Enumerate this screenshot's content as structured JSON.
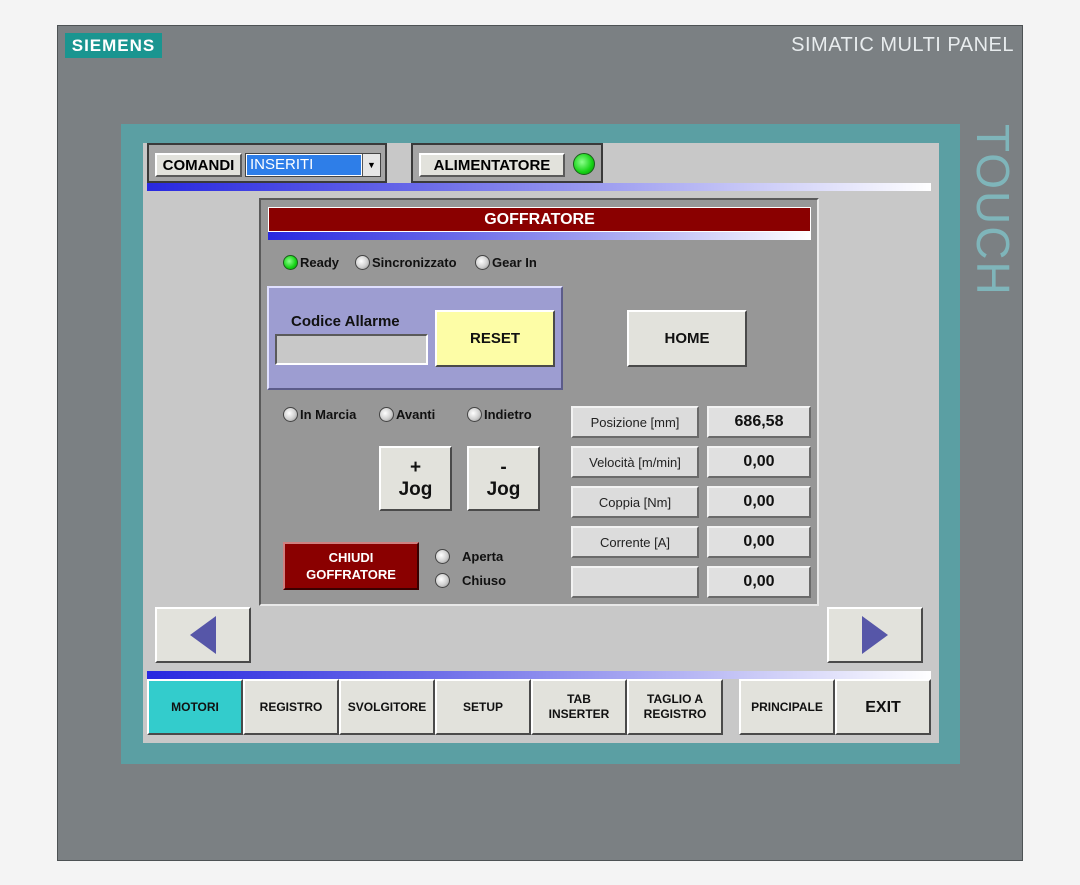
{
  "device": {
    "logo": "SIEMENS",
    "brand": "SIMATIC MULTI PANEL",
    "side_label": "TOUCH"
  },
  "topbar": {
    "comandi_label": "COMANDI",
    "comandi_value": "INSERITI",
    "alimentatore_label": "ALIMENTATORE",
    "alimentatore_state": "on"
  },
  "panel": {
    "title": "GOFFRATORE",
    "status": [
      {
        "label": "Ready",
        "state": "on"
      },
      {
        "label": "Sincronizzato",
        "state": "off"
      },
      {
        "label": "Gear In",
        "state": "off"
      }
    ],
    "alarm": {
      "label": "Codice Allarme",
      "value": "",
      "reset_label": "RESET"
    },
    "home_label": "HOME",
    "motion": [
      {
        "label": "In Marcia",
        "state": "off"
      },
      {
        "label": "Avanti",
        "state": "off"
      },
      {
        "label": "Indietro",
        "state": "off"
      }
    ],
    "jog_plus": {
      "sign": "+",
      "label": "Jog"
    },
    "jog_minus": {
      "sign": "-",
      "label": "Jog"
    },
    "close_button": {
      "line1": "CHIUDI",
      "line2": "GOFFRATORE"
    },
    "close_state": [
      {
        "label": "Aperta",
        "state": "off"
      },
      {
        "label": "Chiuso",
        "state": "off"
      }
    ],
    "values": [
      {
        "label": "Posizione [mm]",
        "value": "686,58"
      },
      {
        "label": "Velocità [m/min]",
        "value": "0,00"
      },
      {
        "label": "Coppia [Nm]",
        "value": "0,00"
      },
      {
        "label": "Corrente [A]",
        "value": "0,00"
      },
      {
        "label": "",
        "value": "0,00"
      }
    ]
  },
  "nav": {
    "prev_icon": "arrow-left-icon",
    "next_icon": "arrow-right-icon",
    "tabs": [
      {
        "line1": "MOTORI",
        "line2": "",
        "active": true
      },
      {
        "line1": "REGISTRO",
        "line2": ""
      },
      {
        "line1": "SVOLGITORE",
        "line2": ""
      },
      {
        "line1": "SETUP",
        "line2": ""
      },
      {
        "line1": "TAB",
        "line2": "INSERTER"
      },
      {
        "line1": "TAGLIO A",
        "line2": "REGISTRO"
      },
      {
        "line1": "PRINCIPALE",
        "line2": ""
      }
    ],
    "exit_label": "EXIT"
  },
  "colors": {
    "accent_teal": "#33cccc",
    "title_red": "#8a0000",
    "lamp_green": "#14d214",
    "reset_yellow": "#fdfda6"
  }
}
